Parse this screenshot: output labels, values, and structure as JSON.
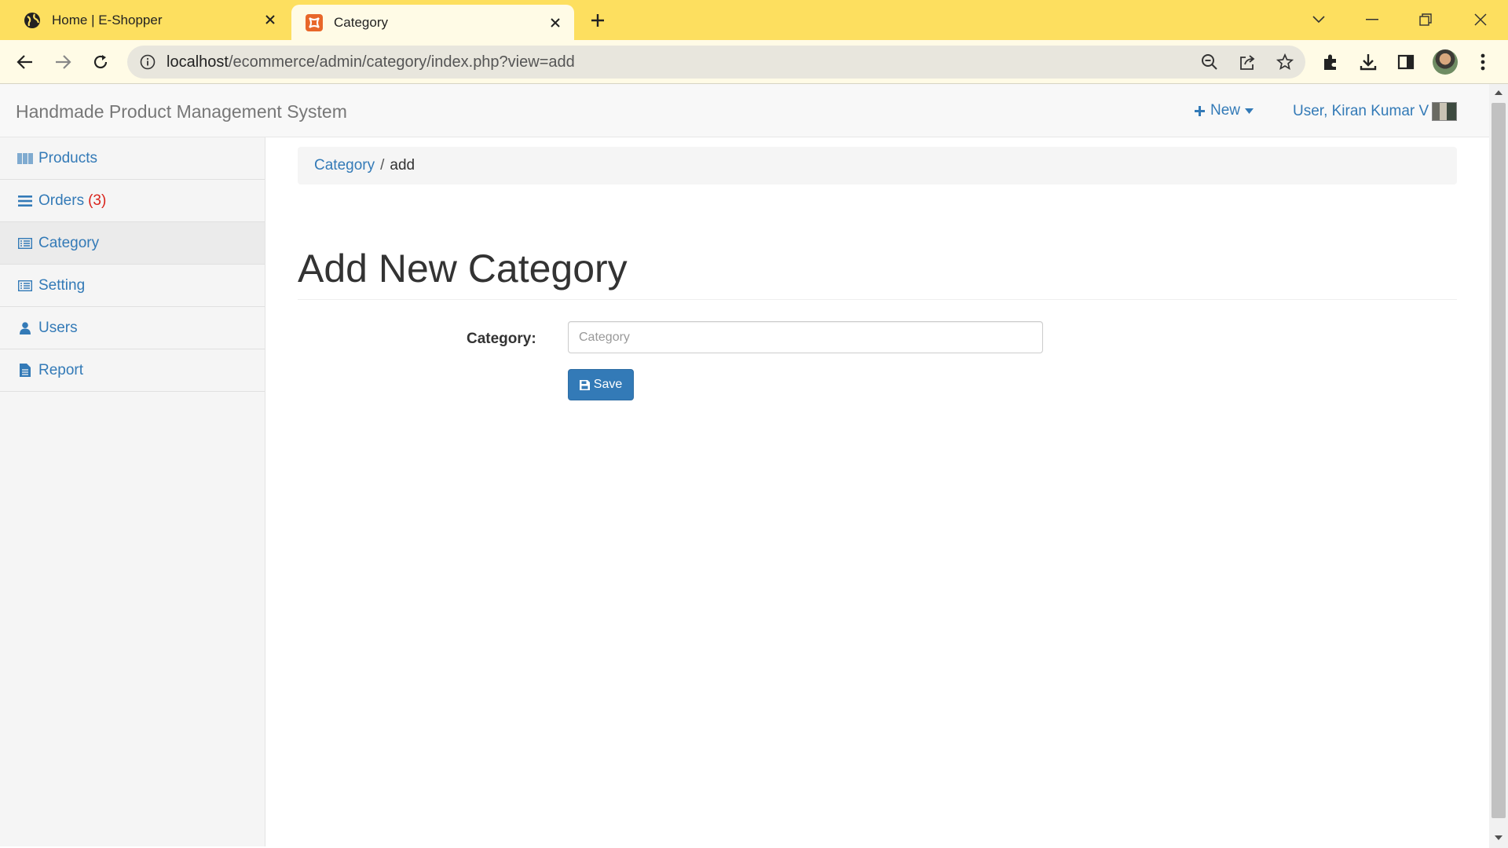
{
  "browser": {
    "tabs": [
      {
        "title": "Home | E-Shopper",
        "favicon": "globe-icon",
        "active": false
      },
      {
        "title": "Category",
        "favicon": "xampp-icon",
        "active": true
      }
    ],
    "url_host": "localhost",
    "url_path": "/ecommerce/admin/category/index.php?view=add",
    "accent": "#fddf5f"
  },
  "app": {
    "brand": "Handmade Product Management System",
    "new_label": "New",
    "user_label": "User, Kiran Kumar V"
  },
  "sidebar": {
    "items": [
      {
        "label": "Products",
        "icon": "barcode-icon"
      },
      {
        "label": "Orders",
        "count": "(3)",
        "icon": "list-icon"
      },
      {
        "label": "Category",
        "icon": "list-alt-icon",
        "active": true
      },
      {
        "label": "Setting",
        "icon": "list-alt-icon"
      },
      {
        "label": "Users",
        "icon": "user-icon"
      },
      {
        "label": "Report",
        "icon": "file-icon"
      }
    ]
  },
  "breadcrumb": {
    "link": "Category",
    "separator": "/",
    "current": "add"
  },
  "page": {
    "title": "Add New Category"
  },
  "form": {
    "category_label": "Category:",
    "category_placeholder": "Category",
    "category_value": "",
    "save_label": "Save"
  },
  "colors": {
    "link": "#337ab7",
    "primary_button": "#337ab7",
    "badge": "#d9241c"
  }
}
